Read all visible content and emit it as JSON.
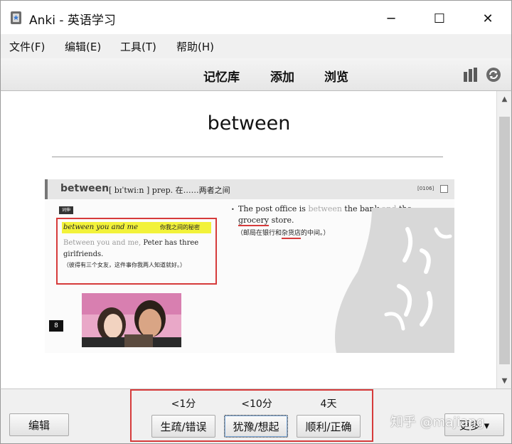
{
  "window": {
    "title": "Anki - 英语学习",
    "minimize_glyph": "─",
    "maximize_glyph": "☐",
    "close_glyph": "✕",
    "icons": [
      "anki-app-icon"
    ]
  },
  "menu": {
    "items": [
      {
        "label": "文件(F)"
      },
      {
        "label": "编辑(E)"
      },
      {
        "label": "工具(T)"
      },
      {
        "label": "帮助(H)"
      }
    ]
  },
  "toolbar": {
    "links": [
      {
        "label": "记忆库"
      },
      {
        "label": "添加"
      },
      {
        "label": "浏览"
      }
    ],
    "icons": [
      "stats-icon",
      "sync-icon"
    ]
  },
  "card": {
    "word": "between",
    "scan": {
      "headword": "between",
      "pronunciation": "[ bɪˈtwiːn ] prep. 在……两者之间",
      "code": "[0106]",
      "phrase_tag": "词伸",
      "phrase_en": "between you and me",
      "phrase_cn": "你我之间的秘密",
      "example1_grey": "Between you and me,",
      "example1_rest": " Peter has three girlfriends.",
      "example1_cn": "（彼得有三个女友，这件事你我两人知道就好。）",
      "bullet": "•",
      "example2_a": "The post office is ",
      "example2_grey1": "between",
      "example2_b": " the bank ",
      "example2_grey2": "and",
      "example2_c": " the ",
      "example2_ul": "grocery",
      "example2_d": " store.",
      "example2_cn_a": "（邮局在银行和",
      "example2_cn_ul": "杂货店",
      "example2_cn_b": "的中间。）",
      "page_number": "8"
    }
  },
  "scrollbar": {
    "up": "▲",
    "down": "▼"
  },
  "bottom": {
    "edit_label": "编辑",
    "more_label": "更多 ▾",
    "answers": [
      {
        "interval": "<1分",
        "label": "生疏/错误"
      },
      {
        "interval": "<10分",
        "label": "犹豫/想起"
      },
      {
        "interval": "4天",
        "label": "顺利/正确"
      }
    ],
    "watermark": "知乎 @majiang"
  },
  "colors": {
    "highlight_red": "#d63b3b",
    "phrase_yellow": "#f2f23a",
    "toolbar_bg": "#ececec"
  }
}
